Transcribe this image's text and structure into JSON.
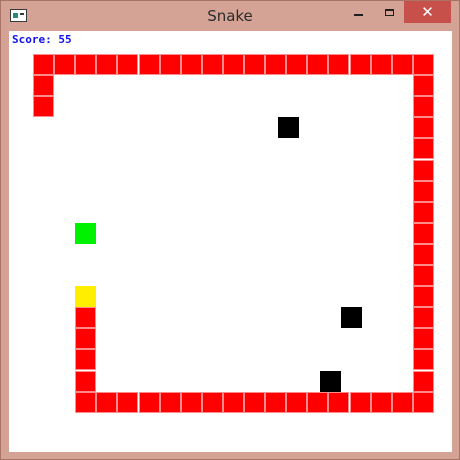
{
  "window": {
    "title": "Snake",
    "close_glyph": "✕"
  },
  "game": {
    "score_text": "Score: 55",
    "colors": {
      "snake_body": "#ff0000",
      "snake_head": "#ffee00",
      "food": "#00f200",
      "obstacle": "#000000",
      "score_text": "#1010f0"
    },
    "icons": [
      "app-icon",
      "minimize-icon",
      "maximize-icon",
      "close-icon"
    ]
  }
}
